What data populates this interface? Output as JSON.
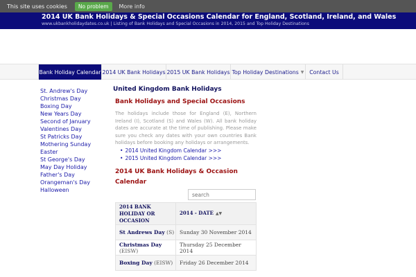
{
  "cookie": {
    "text": "This site uses cookies",
    "accept": "No problem",
    "more": "More info"
  },
  "header": {
    "title": "2014 UK Bank Holidays & Special Occasions Calendar for England, Scotland, Ireland, and Wales",
    "subtitle": "www.ukbankholidaydates.co.uk | Listing of Bank Holidays and Special Occasions in 2014, 2015 and Top Holiday Destinations"
  },
  "nav": {
    "items": [
      {
        "label": "Bank Holiday Calendar"
      },
      {
        "label": "2014 UK Bank Holidays"
      },
      {
        "label": "2015 UK Bank Holidays"
      },
      {
        "label": "Top Holiday Destinations"
      },
      {
        "label": "Contact Us"
      }
    ]
  },
  "sidebar": {
    "links": [
      "St. Andrew's Day",
      "Christmas Day",
      "Boxing Day",
      "New Years Day",
      "Second of January",
      "Valentines Day",
      "St Patricks Day",
      "Mothering Sunday",
      "Easter",
      "St George's Day",
      "May Day Holiday",
      "Father's Day",
      "Orangeman's Day",
      "Halloween"
    ]
  },
  "main": {
    "heading": "United Kingdom Bank Holidays",
    "subheading": "Bank Holidays and Special Occasions",
    "intro": "The holidays include those for England (E), Northern Ireland (I), Scotland (S) and Wales (W). All bank holiday dates are accurate at the time of publishing. Please make sure you check any dates with your own countries Bank holidays before booking any holidays or arrangements.",
    "links": [
      "2014 United Kingdom Calendar >>>",
      "2015 United Kingdom Calendar >>>"
    ],
    "table_heading": "2014 UK Bank Holidays & Occasion Calendar",
    "search_placeholder": "search"
  },
  "table": {
    "headers": [
      "2014 BANK HOLIDAY OR OCCASION",
      "2014 - DATE"
    ],
    "rows": [
      {
        "occasion": "St Andrews Day",
        "region": "(S)",
        "date": "Sunday 30 November 2014"
      },
      {
        "occasion": "Christmas Day",
        "region": "(EISW)",
        "date": "Thursday 25 December 2014"
      },
      {
        "occasion": "Boxing Day",
        "region": "(EISW)",
        "date": "Friday 26 December 2014"
      }
    ]
  },
  "icons": {
    "caret": "caret-down-icon",
    "sort": "sort-icon"
  },
  "colors": {
    "header": "#0c0c7a",
    "accent_red": "#9b1111",
    "link": "#1a1aa8",
    "cookie_button": "#59a84a"
  }
}
